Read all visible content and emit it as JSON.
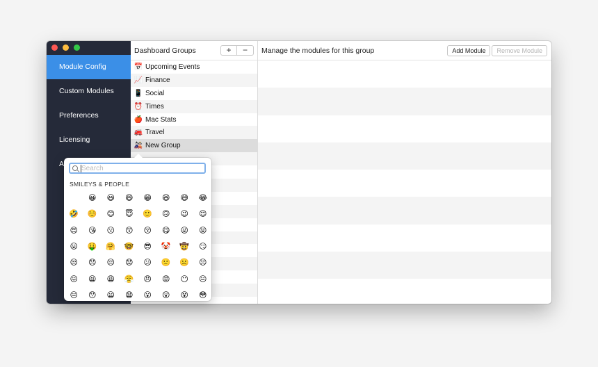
{
  "colors": {
    "sidebar_bg": "#252a39",
    "sidebar_active": "#3b8fe7",
    "close": "#fc5753",
    "minimize": "#fdbc40",
    "zoom": "#33c748",
    "search_focus": "#7fb0ea"
  },
  "sidebar": {
    "items": [
      {
        "label": "Module Config",
        "active": true
      },
      {
        "label": "Custom Modules"
      },
      {
        "label": "Preferences"
      },
      {
        "label": "Licensing"
      },
      {
        "label": "A"
      }
    ]
  },
  "groups": {
    "header": "Dashboard Groups",
    "add_label": "+",
    "remove_label": "−",
    "items": [
      {
        "icon": "📅",
        "label": "Upcoming Events"
      },
      {
        "icon": "📈",
        "label": "Finance"
      },
      {
        "icon": "📱",
        "label": "Social"
      },
      {
        "icon": "⏰",
        "label": "Times"
      },
      {
        "icon": "🍎",
        "label": "Mac Stats"
      },
      {
        "icon": "🚒",
        "label": "Travel"
      },
      {
        "icon": "🎎",
        "label": "New Group",
        "selected": true
      }
    ]
  },
  "modules": {
    "header": "Manage the modules for this group",
    "add_button": "Add Module",
    "remove_button": "Remove Module"
  },
  "emoji_picker": {
    "search_placeholder": "Search",
    "category": "SMILEYS & PEOPLE",
    "emojis": [
      "",
      "😀",
      "😃",
      "😄",
      "😁",
      "😆",
      "😅",
      "😂",
      "🤣",
      "☺️",
      "😊",
      "😇",
      "🙂",
      "🙃",
      "😉",
      "😌",
      "😍",
      "😘",
      "😗",
      "😙",
      "😚",
      "😋",
      "😜",
      "😝",
      "😛",
      "🤑",
      "🤗",
      "🤓",
      "😎",
      "🤡",
      "🤠",
      "😏",
      "😒",
      "😞",
      "😔",
      "😟",
      "😕",
      "🙁",
      "☹️",
      "😣",
      "😖",
      "😫",
      "😩",
      "😤",
      "😠",
      "😡",
      "😶",
      "😐",
      "😑",
      "😯",
      "😦",
      "😧",
      "😮",
      "😲",
      "😵",
      "😳"
    ]
  }
}
